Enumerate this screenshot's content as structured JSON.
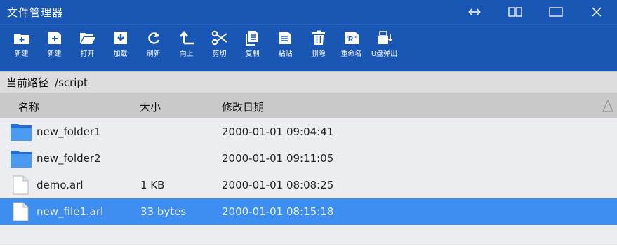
{
  "window": {
    "title": "文件管理器",
    "controls": [
      {
        "name": "swap-icon"
      },
      {
        "name": "restore-icon"
      },
      {
        "name": "maximize-icon"
      },
      {
        "name": "close-icon"
      }
    ]
  },
  "toolbar": {
    "items": [
      {
        "id": "new-folder",
        "label": "新建",
        "icon": "new-folder-icon"
      },
      {
        "id": "new-file",
        "label": "新建",
        "icon": "new-file-icon"
      },
      {
        "id": "open",
        "label": "打开",
        "icon": "open-folder-icon"
      },
      {
        "id": "load",
        "label": "加载",
        "icon": "load-icon"
      },
      {
        "id": "refresh",
        "label": "刷新",
        "icon": "refresh-icon"
      },
      {
        "id": "up",
        "label": "向上",
        "icon": "up-arrow-icon"
      },
      {
        "id": "cut",
        "label": "剪切",
        "icon": "scissors-icon"
      },
      {
        "id": "copy",
        "label": "复制",
        "icon": "copy-icon"
      },
      {
        "id": "paste",
        "label": "粘贴",
        "icon": "paste-icon"
      },
      {
        "id": "delete",
        "label": "删除",
        "icon": "trash-icon"
      },
      {
        "id": "rename",
        "label": "重命名",
        "icon": "rename-icon"
      },
      {
        "id": "eject",
        "label": "U盘弹出",
        "icon": "usb-eject-icon"
      }
    ]
  },
  "path": {
    "label": "当前路径",
    "value": "/script"
  },
  "list": {
    "columns": [
      "名称",
      "大小",
      "修改日期"
    ],
    "rows": [
      {
        "type": "folder",
        "name": "new_folder1",
        "size": "",
        "date": "2000-01-01 09:04:41",
        "selected": false
      },
      {
        "type": "folder",
        "name": "new_folder2",
        "size": "",
        "date": "2000-01-01 09:11:05",
        "selected": false
      },
      {
        "type": "file",
        "name": "demo.arl",
        "size": "1 KB",
        "date": "2000-01-01 08:08:25",
        "selected": false
      },
      {
        "type": "file",
        "name": "new_file1.arl",
        "size": "33 bytes",
        "date": "2000-01-01 08:15:18",
        "selected": true
      }
    ]
  },
  "colors": {
    "titlebar": "#1a56b4",
    "selection": "#3d8ef0",
    "folder": "#3f8fe6"
  }
}
